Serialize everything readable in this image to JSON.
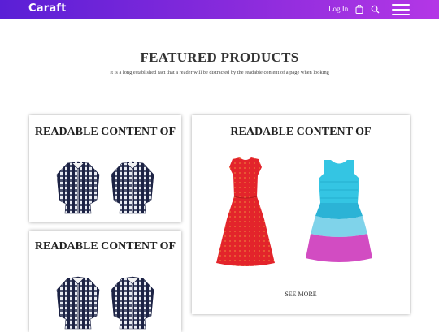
{
  "header": {
    "logo": "Caraft",
    "login_label": "Log In",
    "icons": [
      "shopping-bag-icon",
      "search-icon",
      "hamburger-menu-icon"
    ]
  },
  "featured": {
    "title": "FEATURED PRODUCTS",
    "subtitle": "It is a long established fact that a reader will be distracted by the readable content of a page when looking"
  },
  "cards": [
    {
      "title": "READABLE CONTENT OF"
    },
    {
      "title": "READABLE CONTENT OF"
    },
    {
      "title": "READABLE CONTENT OF",
      "button": "SEE MORE"
    }
  ],
  "colors": {
    "header_gradient": [
      "#5a1fd6",
      "#b437e6"
    ],
    "shirt": "#1c2244",
    "red_dress": "#e3242b",
    "dress_teal": "#34c5e3",
    "dress_magenta": "#d24cc2"
  }
}
